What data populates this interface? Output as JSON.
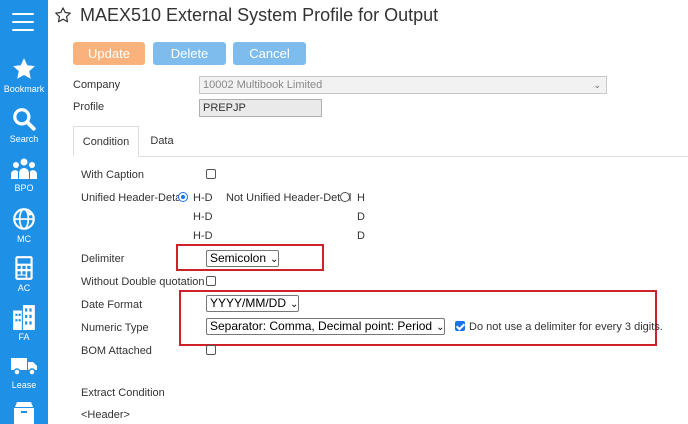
{
  "sidebar": {
    "items": [
      {
        "label": "Bookmark",
        "icon": "star-icon"
      },
      {
        "label": "Search",
        "icon": "search-icon"
      },
      {
        "label": "BPO",
        "icon": "people-icon"
      },
      {
        "label": "MC",
        "icon": "globe-icon"
      },
      {
        "label": "AC",
        "icon": "calculator-icon"
      },
      {
        "label": "FA",
        "icon": "building-icon"
      },
      {
        "label": "Lease",
        "icon": "truck-icon"
      },
      {
        "label": "",
        "icon": "box-icon"
      }
    ]
  },
  "header": {
    "title": "MAEX510 External System Profile for Output"
  },
  "toolbar": {
    "update_label": "Update",
    "delete_label": "Delete",
    "cancel_label": "Cancel"
  },
  "form": {
    "company_label": "Company",
    "company_value": "10002 Multibook Limited",
    "profile_label": "Profile",
    "profile_value": "PREPJP"
  },
  "tabs": [
    {
      "label": "Condition",
      "active": true
    },
    {
      "label": "Data",
      "active": false
    }
  ],
  "condition": {
    "with_caption_label": "With Caption",
    "with_caption_checked": false,
    "unified_label": "Unified Header-Detail",
    "unified_value": "H-D",
    "unified_selected": true,
    "not_unified_label": "Not Unified Header-Detail",
    "not_unified_value": "H",
    "unified_rows": [
      "H-D",
      "H-D"
    ],
    "not_unified_rows": [
      "D",
      "D"
    ],
    "delimiter_label": "Delimiter",
    "delimiter_value": "Semicolon",
    "without_dq_label": "Without Double quotation",
    "without_dq_checked": false,
    "date_format_label": "Date Format",
    "date_format_value": "YYYY/MM/DD",
    "numeric_type_label": "Numeric Type",
    "numeric_type_value": "Separator: Comma, Decimal point: Period",
    "no_delimiter_label": "Do not use a delimiter for every 3 digits.",
    "no_delimiter_checked": true,
    "bom_label": "BOM Attached",
    "bom_checked": false,
    "extract_label": "Extract Condition",
    "header_label": "<Header>"
  },
  "colors": {
    "sidebar": "#1e90e6",
    "update_button": "#f9b27b",
    "secondary_button": "#7fbcee",
    "highlight": "#d0202a"
  }
}
